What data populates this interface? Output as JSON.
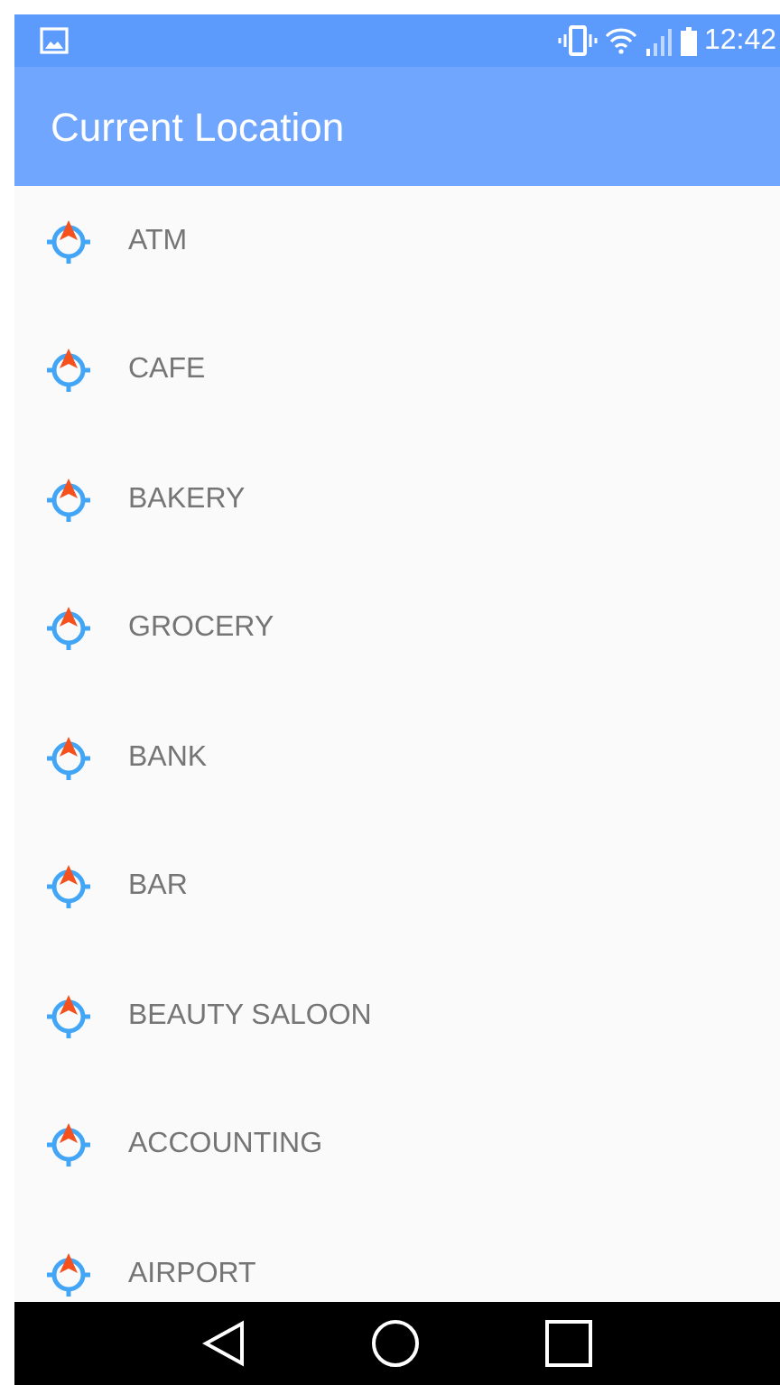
{
  "status_bar": {
    "time": "12:42"
  },
  "app_bar": {
    "title": "Current Location"
  },
  "places": [
    {
      "label": "ATM"
    },
    {
      "label": "CAFE"
    },
    {
      "label": "BAKERY"
    },
    {
      "label": "GROCERY"
    },
    {
      "label": "BANK"
    },
    {
      "label": "BAR"
    },
    {
      "label": "BEAUTY SALOON"
    },
    {
      "label": "ACCOUNTING"
    },
    {
      "label": "AIRPORT"
    }
  ]
}
